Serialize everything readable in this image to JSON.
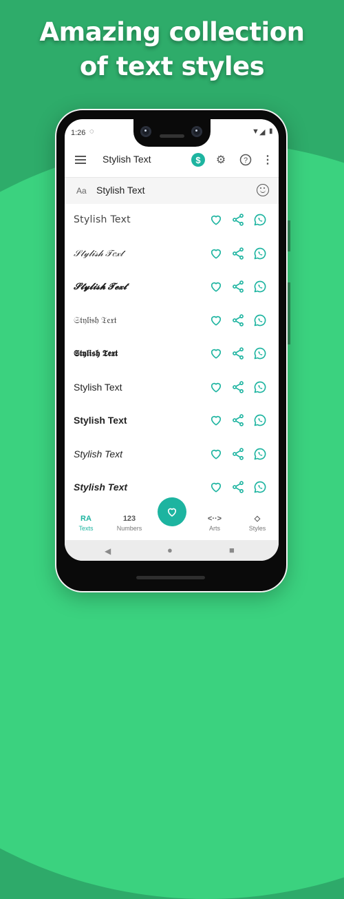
{
  "headline": {
    "line1": "Amazing collection",
    "line2": "of text styles"
  },
  "colors": {
    "accent": "#1db4a0",
    "bg_dark": "#2eac6a",
    "bg_light": "#3bd27f"
  },
  "status_bar": {
    "time": "1:26",
    "left_icon": "sync-icon",
    "right_icons": [
      "wifi-icon",
      "signal-icon",
      "battery-icon"
    ]
  },
  "app_bar": {
    "title": "Stylish Text",
    "icons": [
      "menu-icon",
      "dollar-icon",
      "settings-icon",
      "help-icon",
      "more-vert-icon"
    ]
  },
  "input": {
    "prefix": "Aa",
    "value": "Stylish Text",
    "trailing_icon": "emoji-icon"
  },
  "styles": [
    {
      "text": "Stylish Text",
      "style": "outline"
    },
    {
      "text": "𝒮𝓉𝓎𝓁𝒾𝓈𝒽 𝒯𝑒𝓍𝓉",
      "style": "script"
    },
    {
      "text": "𝓢𝓽𝔂𝓵𝓲𝓼𝓱 𝓣𝓮𝔁𝓽",
      "style": "bold-script"
    },
    {
      "text": "𝔖𝔱𝔶𝔩𝔦𝔰𝔥 𝔗𝔢𝔵𝔱",
      "style": "fraktur"
    },
    {
      "text": "𝕾𝖙𝖞𝖑𝖎𝖘𝖍 𝕿𝖊𝖝𝖙",
      "style": "bold-fraktur"
    },
    {
      "text": "Stylish Text",
      "style": "sans"
    },
    {
      "text": "Stylish Text",
      "style": "sans-bold"
    },
    {
      "text": "Stylish Text",
      "style": "sans-italic"
    },
    {
      "text": "Stylish Text",
      "style": "sans-bold-italic"
    }
  ],
  "row_actions": [
    "favorite-icon",
    "share-icon",
    "whatsapp-icon"
  ],
  "bottom_nav": [
    {
      "glyph": "RA",
      "label": "Texts",
      "active": true
    },
    {
      "glyph": "123",
      "label": "Numbers",
      "active": false
    },
    {
      "glyph": "<··>",
      "label": "Arts",
      "active": false
    },
    {
      "glyph": "◇",
      "label": "Styles",
      "active": false
    }
  ],
  "fab": {
    "icon": "heart-icon"
  },
  "system_nav": {
    "back": "◀",
    "home": "●",
    "recents": "■"
  }
}
